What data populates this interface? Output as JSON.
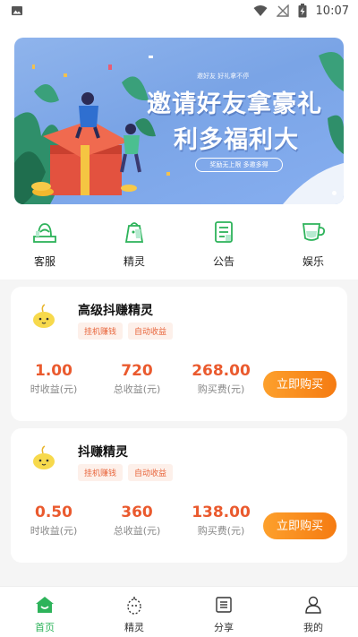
{
  "status_bar": {
    "time": "10:07"
  },
  "banner": {
    "small_text": "邀好友 好礼拿不停",
    "title_line1": "邀请好友拿豪礼",
    "title_line2": "利多福利大",
    "pill_text": "奖励无上限 多邀多得"
  },
  "quick_nav": [
    {
      "label": "客服",
      "icon": "customer-service-icon"
    },
    {
      "label": "精灵",
      "icon": "sprite-bag-icon"
    },
    {
      "label": "公告",
      "icon": "announcement-icon"
    },
    {
      "label": "娱乐",
      "icon": "cup-icon"
    }
  ],
  "products": [
    {
      "name": "高级抖赚精灵",
      "tags": [
        "挂机赚钱",
        "自动收益"
      ],
      "hourly": {
        "value": "1.00",
        "label": "时收益(元)"
      },
      "total": {
        "value": "720",
        "label": "总收益(元)"
      },
      "price": {
        "value": "268.00",
        "label": "购买费(元)"
      },
      "buy_label": "立即购买"
    },
    {
      "name": "抖赚精灵",
      "tags": [
        "挂机赚钱",
        "自动收益"
      ],
      "hourly": {
        "value": "0.50",
        "label": "时收益(元)"
      },
      "total": {
        "value": "360",
        "label": "总收益(元)"
      },
      "price": {
        "value": "138.00",
        "label": "购买费(元)"
      },
      "buy_label": "立即购买"
    }
  ],
  "bottom_nav": [
    {
      "label": "首页",
      "icon": "home-icon",
      "active": true
    },
    {
      "label": "精灵",
      "icon": "sprite-icon",
      "active": false
    },
    {
      "label": "分享",
      "icon": "share-icon",
      "active": false
    },
    {
      "label": "我的",
      "icon": "profile-icon",
      "active": false
    }
  ],
  "colors": {
    "accent_green": "#2db35a",
    "value_orange": "#ea5a2e",
    "button_gradient_start": "#fda02c",
    "button_gradient_end": "#f57b12"
  }
}
